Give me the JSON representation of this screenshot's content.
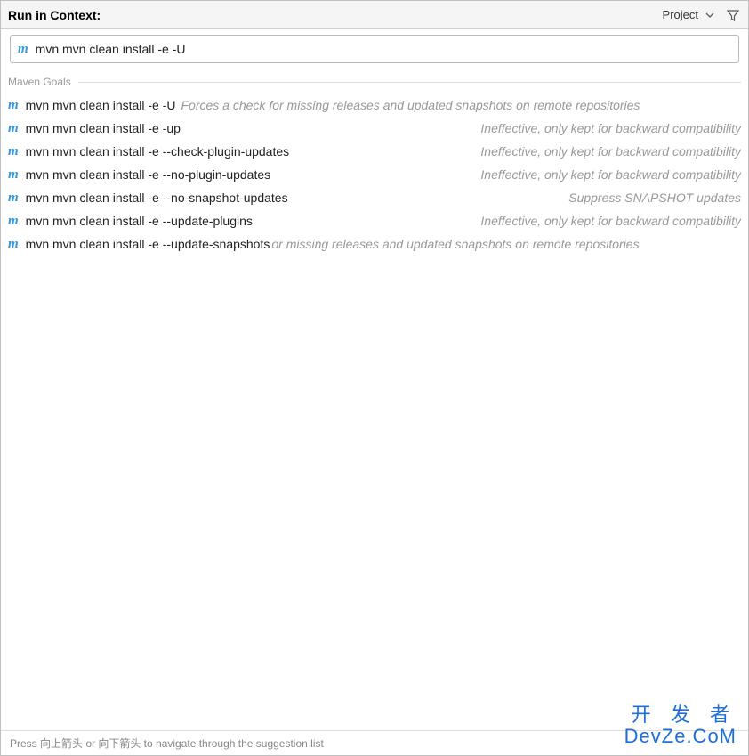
{
  "header": {
    "title": "Run in Context:",
    "scope": "Project"
  },
  "input": {
    "value": "mvn mvn clean install -e -U"
  },
  "section": {
    "label": "Maven Goals"
  },
  "suggestions": [
    {
      "command": "mvn mvn clean install -e -U",
      "desc": "Forces a check for missing releases and updated snapshots on remote repositories"
    },
    {
      "command": "mvn mvn clean install -e -up",
      "desc": "Ineffective, only kept for backward compatibility"
    },
    {
      "command": "mvn mvn clean install -e --check-plugin-updates",
      "desc": "Ineffective, only kept for backward compatibility"
    },
    {
      "command": "mvn mvn clean install -e --no-plugin-updates",
      "desc": "Ineffective, only kept for backward compatibility"
    },
    {
      "command": "mvn mvn clean install -e --no-snapshot-updates",
      "desc": "Suppress SNAPSHOT updates"
    },
    {
      "command": "mvn mvn clean install -e --update-plugins",
      "desc": "Ineffective, only kept for backward compatibility"
    },
    {
      "command": "mvn mvn clean install -e --update-snapshots",
      "desc": "or missing releases and updated snapshots on remote repositories"
    }
  ],
  "footer": {
    "hint": "Press 向上箭头 or 向下箭头 to navigate through the suggestion list"
  },
  "watermark": {
    "line1": "开 发 者",
    "line2": "DevZe.CoM"
  }
}
